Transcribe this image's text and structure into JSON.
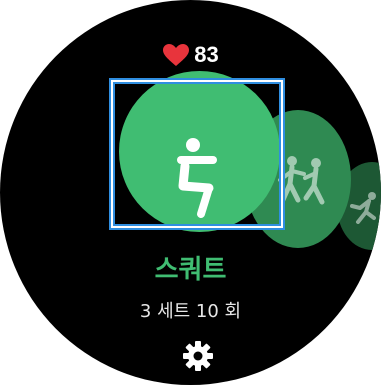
{
  "heart_rate": {
    "icon": "heart-icon",
    "value": "83",
    "icon_color": "#e8343c"
  },
  "exercise": {
    "name": "스쿼트",
    "target": "3 세트 10 회",
    "accent_color": "#40bd72",
    "main_icon": "squat-icon",
    "next_icons": [
      "martial-arts-icon",
      "running-icon"
    ]
  },
  "controls": {
    "settings_icon": "gear-icon"
  }
}
